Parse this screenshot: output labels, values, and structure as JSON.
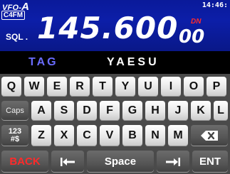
{
  "vfo": {
    "label_prefix": "VFO-",
    "label_letter": "A",
    "mode": "C4FM",
    "clock": "14:46:",
    "sql": "SQL .",
    "freq_main": "145.600",
    "freq_small": "00",
    "dn": "DN"
  },
  "entry": {
    "label": "TAG",
    "value": "YAESU"
  },
  "keyboard": {
    "row1": [
      "Q",
      "W",
      "E",
      "R",
      "T",
      "Y",
      "U",
      "I",
      "O",
      "P"
    ],
    "row2": [
      "A",
      "S",
      "D",
      "F",
      "G",
      "H",
      "J",
      "K",
      "L"
    ],
    "row3": [
      "Z",
      "X",
      "C",
      "V",
      "B",
      "N",
      "M"
    ],
    "caps": "Caps",
    "numsym_top": "123",
    "numsym_bottom": "#$",
    "back": "BACK",
    "space": "Space",
    "ent": "ENT",
    "icons": {
      "backspace": "backspace-icon",
      "cursor_left": "cursor-left-icon",
      "cursor_right": "cursor-right-icon"
    }
  }
}
